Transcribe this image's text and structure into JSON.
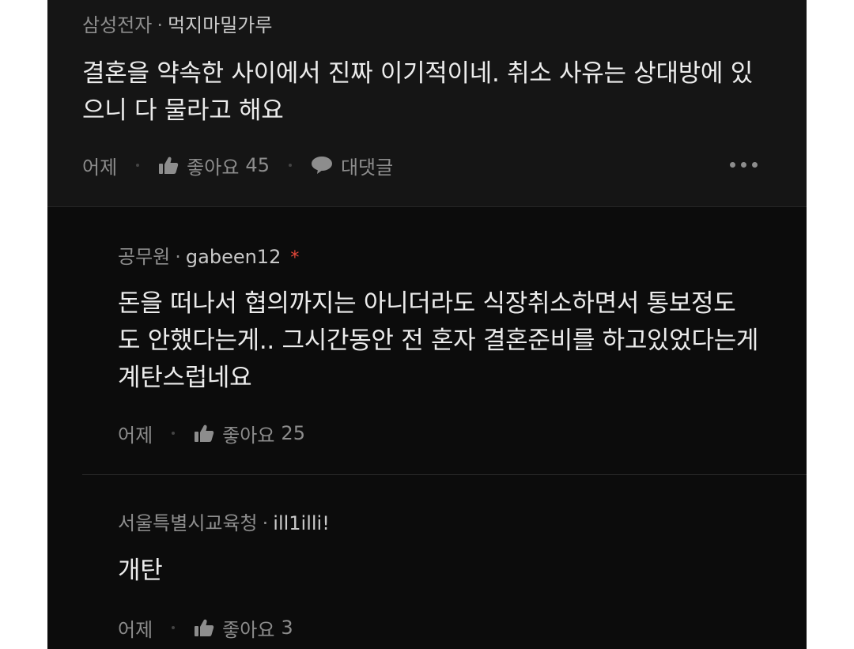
{
  "comments": [
    {
      "company": "삼성전자",
      "separator": "·",
      "nickname": "먹지마밀가루",
      "lines": [
        "결혼을 약속한 사이에서 진짜 이기적이네. 취소 사유는 상대방에 있",
        "으니 다 물라고 해요"
      ],
      "time": "어제",
      "like_label": "좋아요",
      "like_count": "45",
      "reply_label": "대댓글"
    }
  ],
  "replies": [
    {
      "company": "공무원",
      "separator": "·",
      "nickname": "gabeen12",
      "badge": "*",
      "lines": [
        "돈을 떠나서 협의까지는 아니더라도 식장취소하면서 통보정도",
        "도 안했다는게.. 그시간동안 전 혼자 결혼준비를 하고있었다는게",
        "계탄스럽네요"
      ],
      "time": "어제",
      "like_label": "좋아요",
      "like_count": "25"
    },
    {
      "company": "서울특별시교육청",
      "separator": "·",
      "nickname": "ill1illi!",
      "lines": [
        "개탄"
      ],
      "time": "어제",
      "like_label": "좋아요",
      "like_count": "3"
    }
  ],
  "icons": {
    "like": "thumbs-up-icon",
    "reply": "speech-bubble-icon",
    "more": "more-dots-icon"
  },
  "colors": {
    "background": "#0c0c0c",
    "top_comment_background": "#151515",
    "text": "#ececec",
    "muted": "#8d8d8d",
    "badge": "#e5483a"
  }
}
